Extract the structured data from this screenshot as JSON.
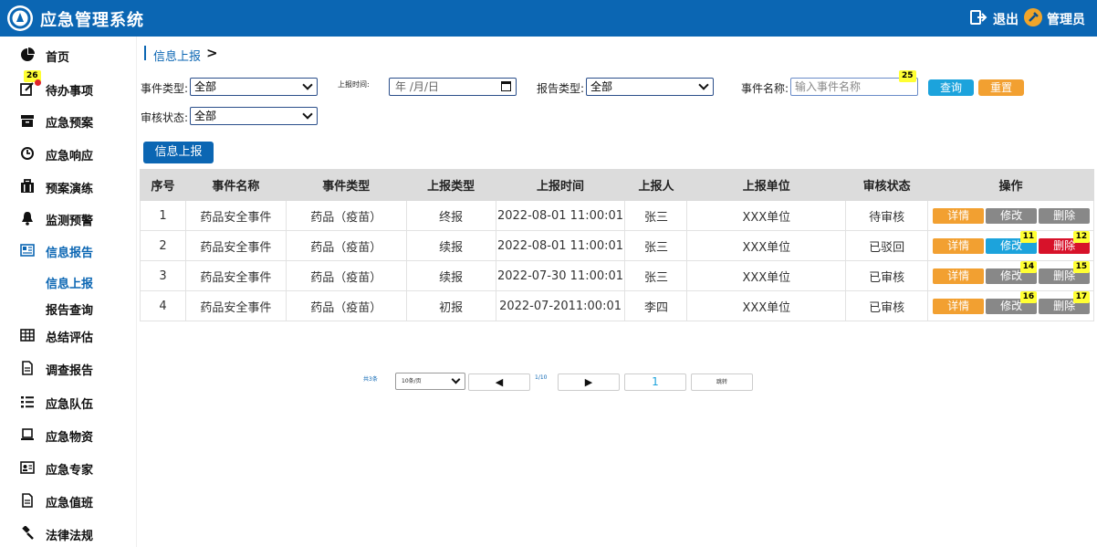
{
  "header": {
    "title": "应急管理系统",
    "logout_label": "退出",
    "user_label": "管理员"
  },
  "sidebar": {
    "todo_badge": "26",
    "items": [
      {
        "label": "首页",
        "icon": "pie-chart-icon"
      },
      {
        "label": "待办事项",
        "icon": "edit-icon"
      },
      {
        "label": "应急预案",
        "icon": "archive-icon"
      },
      {
        "label": "应急响应",
        "icon": "clock-icon"
      },
      {
        "label": "预案演练",
        "icon": "briefcase-icon"
      },
      {
        "label": "监测预警",
        "icon": "bell-icon"
      },
      {
        "label": "信息报告",
        "icon": "newspaper-icon"
      },
      {
        "label": "总结评估",
        "icon": "table-icon"
      },
      {
        "label": "调查报告",
        "icon": "document-icon"
      },
      {
        "label": "应急队伍",
        "icon": "list-icon"
      },
      {
        "label": "应急物资",
        "icon": "laptop-icon"
      },
      {
        "label": "应急专家",
        "icon": "id-card-icon"
      },
      {
        "label": "应急值班",
        "icon": "document-icon"
      },
      {
        "label": "法律法规",
        "icon": "gavel-icon"
      }
    ],
    "sub_items": [
      {
        "label": "信息上报"
      },
      {
        "label": "报告查询"
      }
    ]
  },
  "breadcrumb": {
    "current": "信息上报",
    "arrow": ">"
  },
  "filters": {
    "event_type_label": "事件类型:",
    "event_type_value": "全部",
    "report_time_label": "上报时间:",
    "report_time_placeholder": "年 /月/日",
    "report_type_label": "报告类型:",
    "report_type_value": "全部",
    "event_name_label": "事件名称:",
    "event_name_placeholder": "输入事件名称",
    "event_name_badge": "25",
    "audit_status_label": "审核状态:",
    "audit_status_value": "全部",
    "query_label": "查询",
    "reset_label": "重置",
    "report_button_label": "信息上报"
  },
  "table": {
    "headers": [
      "序号",
      "事件名称",
      "事件类型",
      "上报类型",
      "上报时间",
      "上报人",
      "上报单位",
      "审核状态",
      "操作"
    ],
    "op_labels": {
      "detail": "详情",
      "edit": "修改",
      "delete": "删除"
    },
    "rows": [
      {
        "no": "1",
        "name": "药品安全事件",
        "type": "药品（疫苗）",
        "report_type": "终报",
        "time": "2022-08-01 11:00:01",
        "reporter": "张三",
        "unit": "XXX单位",
        "status": "待审核",
        "edit_badge": "",
        "delete_badge": ""
      },
      {
        "no": "2",
        "name": "药品安全事件",
        "type": "药品（疫苗）",
        "report_type": "续报",
        "time": "2022-08-01 11:00:01",
        "reporter": "张三",
        "unit": "XXX单位",
        "status": "已驳回",
        "edit_badge": "11",
        "delete_badge": "12"
      },
      {
        "no": "3",
        "name": "药品安全事件",
        "type": "药品（疫苗）",
        "report_type": "续报",
        "time": "2022-07-30 11:00:01",
        "reporter": "张三",
        "unit": "XXX单位",
        "status": "已审核",
        "edit_badge": "14",
        "delete_badge": "15"
      },
      {
        "no": "4",
        "name": "药品安全事件",
        "type": "药品（疫苗）",
        "report_type": "初报",
        "time": "2022-07-2011:00:01",
        "reporter": "李四",
        "unit": "XXX单位",
        "status": "已审核",
        "edit_badge": "16",
        "delete_badge": "17"
      }
    ]
  },
  "pager": {
    "total": "共3条",
    "page_size": "10条/页",
    "prev": "◀",
    "next": "▶",
    "page_info": "1/10",
    "page_input": "1",
    "jump": "跳转"
  }
}
